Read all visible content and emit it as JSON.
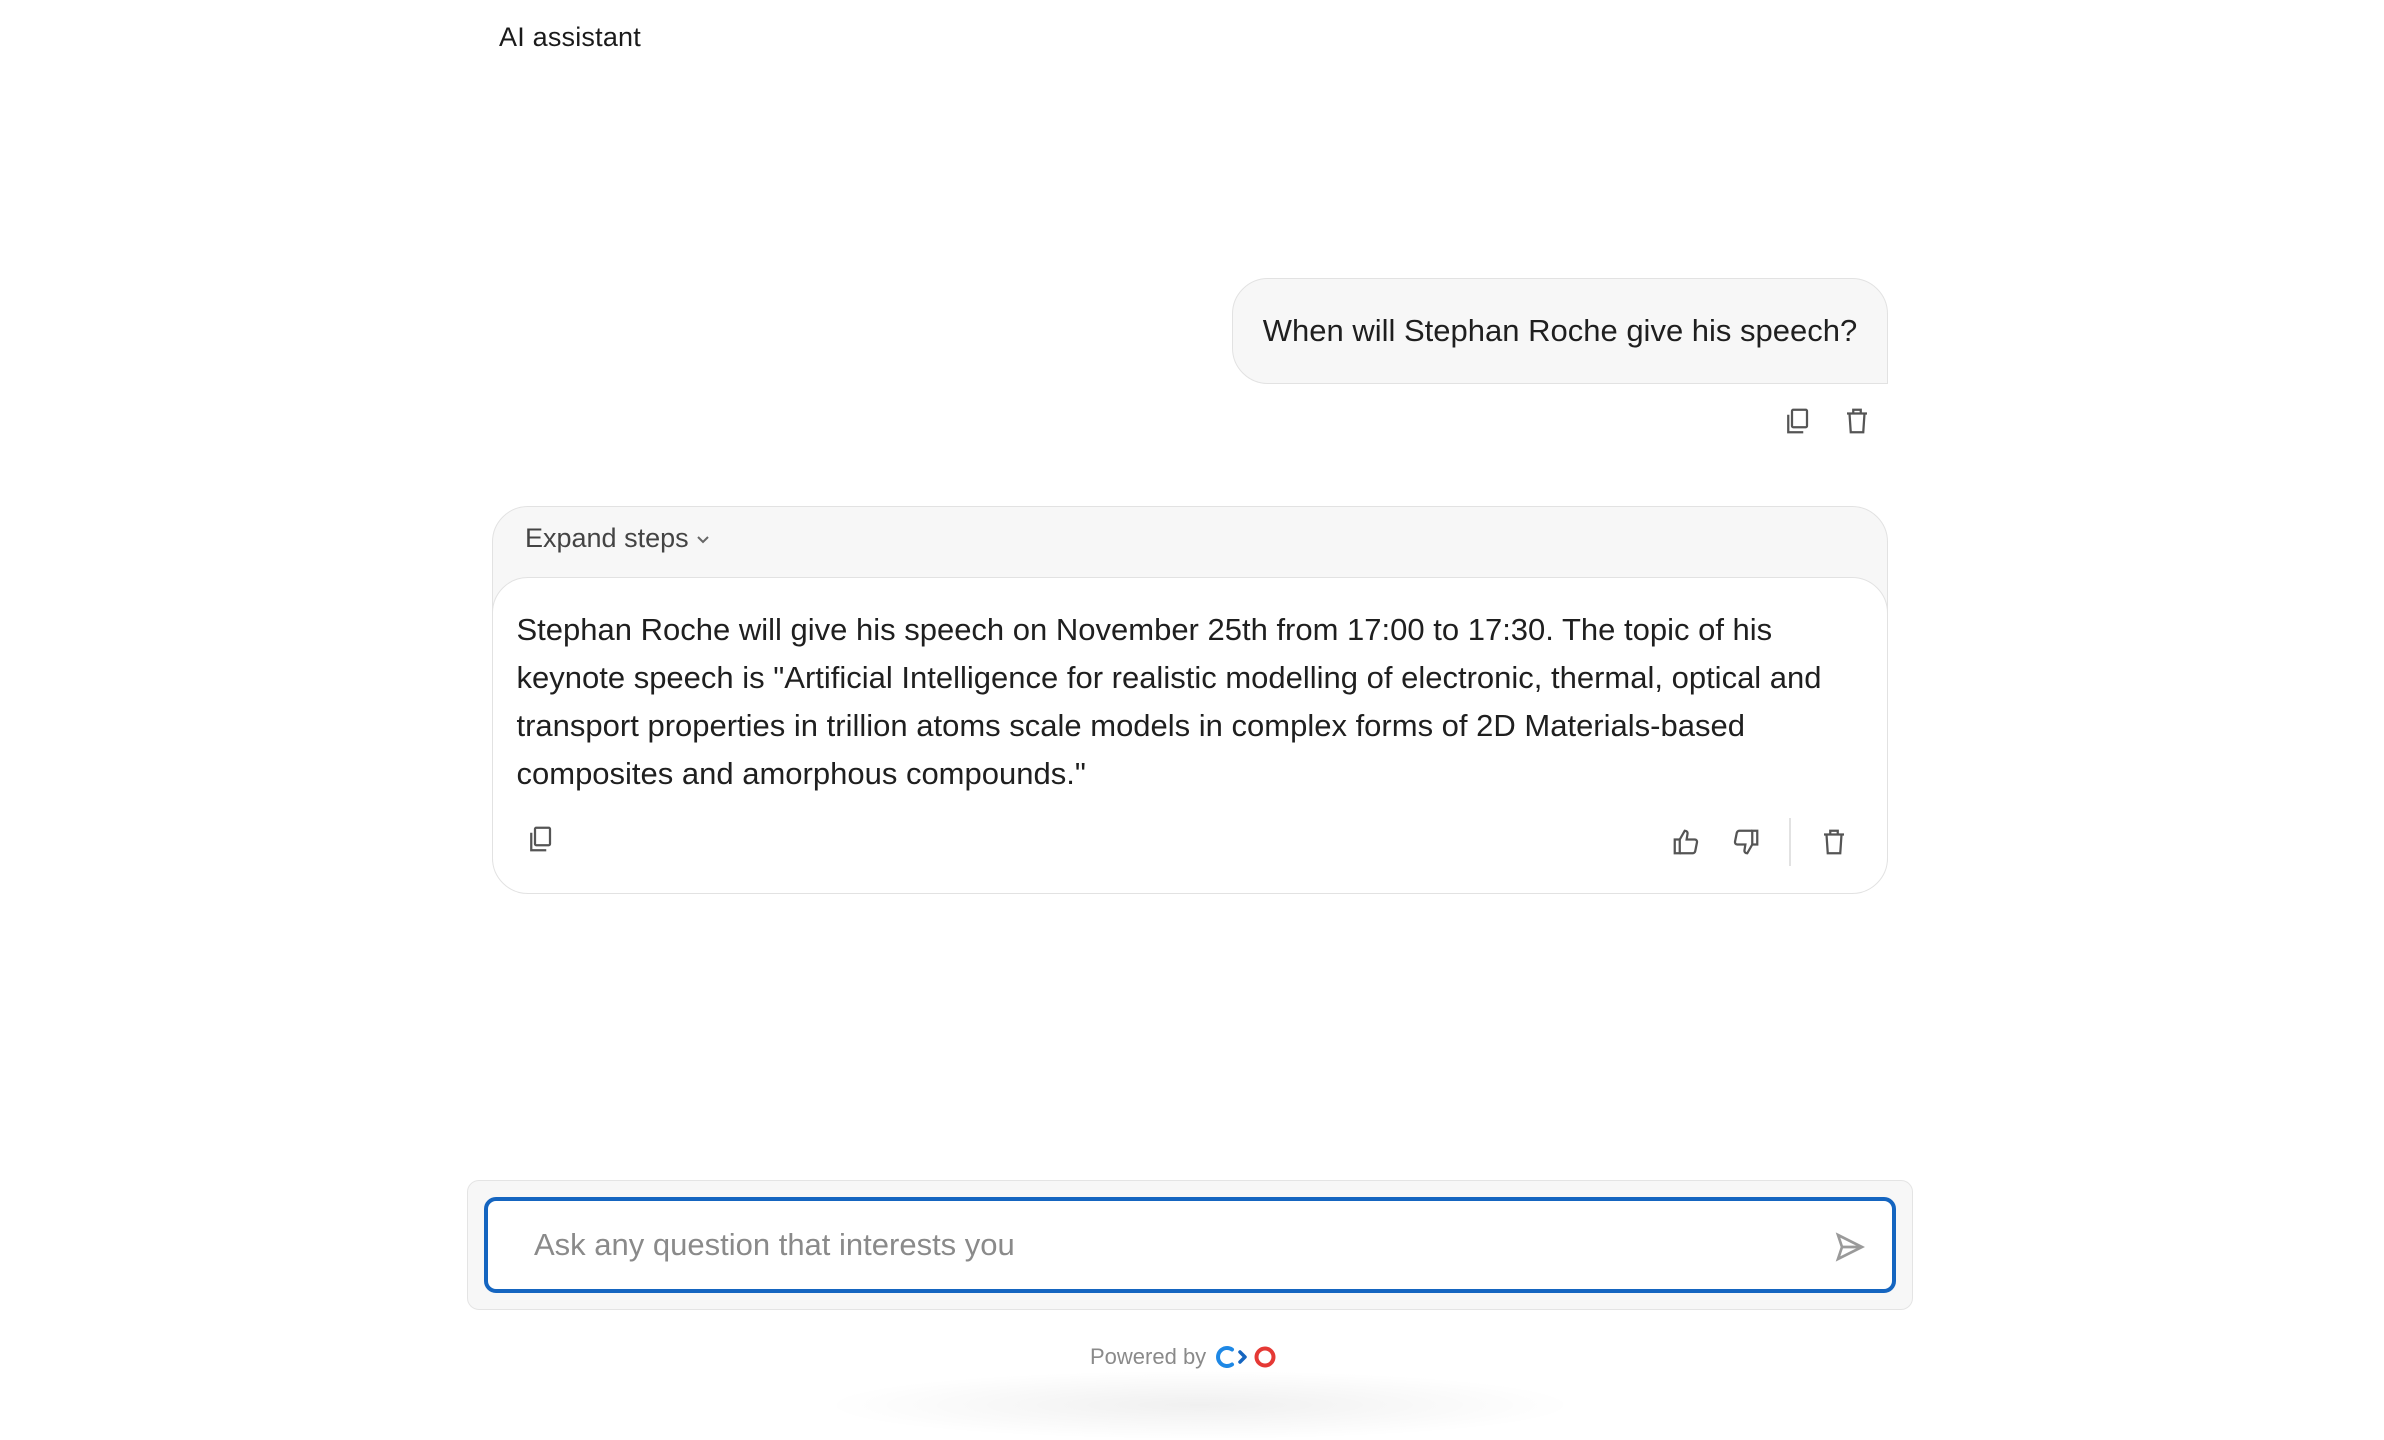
{
  "header": {
    "title": "AI assistant"
  },
  "conversation": {
    "user_message": {
      "text": "When will Stephan Roche give his speech?"
    },
    "assistant_message": {
      "expand_label": "Expand steps",
      "text": "Stephan Roche will give his speech on November 25th from 17:00 to 17:30. The topic of his keynote speech is \"Artificial Intelligence for realistic modelling of electronic, thermal, optical and transport properties in trillion atoms scale models in complex forms of 2D Materials-based composites and amorphous compounds.\""
    }
  },
  "icons": {
    "copy": "copy-icon",
    "delete": "trash-icon",
    "like": "thumbs-up-icon",
    "dislike": "thumbs-down-icon",
    "send": "send-icon",
    "expand": "chevron-down-icon"
  },
  "composer": {
    "placeholder": "Ask any question that interests you",
    "value": ""
  },
  "footer": {
    "powered_by": "Powered by"
  },
  "colors": {
    "accent": "#1565c0",
    "brand_blue": "#1e88e5",
    "brand_red": "#e53935",
    "surface": "#f7f7f7",
    "border": "#e2e2e2"
  }
}
